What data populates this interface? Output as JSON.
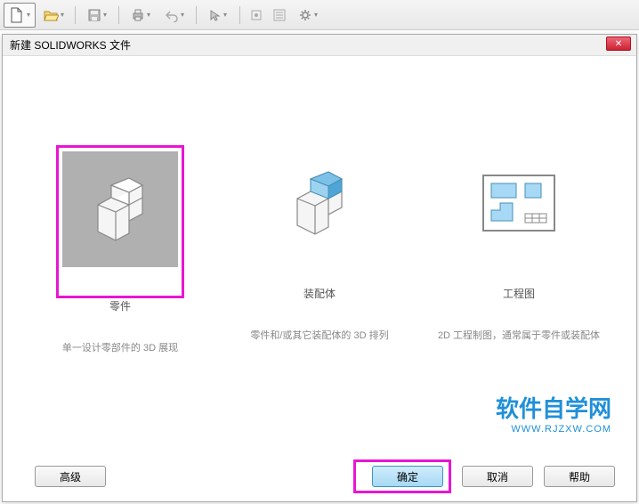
{
  "dialog": {
    "title": "新建 SOLIDWORKS 文件",
    "options": [
      {
        "title": "零件",
        "desc": "单一设计零部件的 3D 展现"
      },
      {
        "title": "装配体",
        "desc": "零件和/或其它装配体的 3D 排列"
      },
      {
        "title": "工程图",
        "desc": "2D 工程制图，通常属于零件或装配体"
      }
    ],
    "buttons": {
      "advanced": "高级",
      "ok": "确定",
      "cancel": "取消",
      "help": "帮助"
    }
  },
  "watermark": {
    "title": "软件自学网",
    "url": "WWW.RJZXW.COM"
  }
}
